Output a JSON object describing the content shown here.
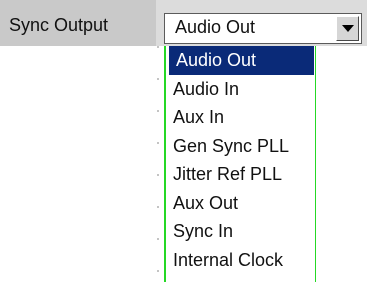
{
  "sync_output": {
    "label": "Sync Output",
    "selected_value": "Audio Out",
    "options": [
      "Audio Out",
      "Audio In",
      "Aux In",
      "Gen Sync PLL",
      "Jitter Ref PLL",
      "Aux Out",
      "Sync In",
      "Internal Clock"
    ],
    "highlighted_index": 0,
    "colors": {
      "highlight": "#0a2a78",
      "dropdown_border": "#25d825",
      "label_bg": "#c9c9c9"
    },
    "icons": {
      "dropdown_button": "triangle-down-icon"
    }
  }
}
